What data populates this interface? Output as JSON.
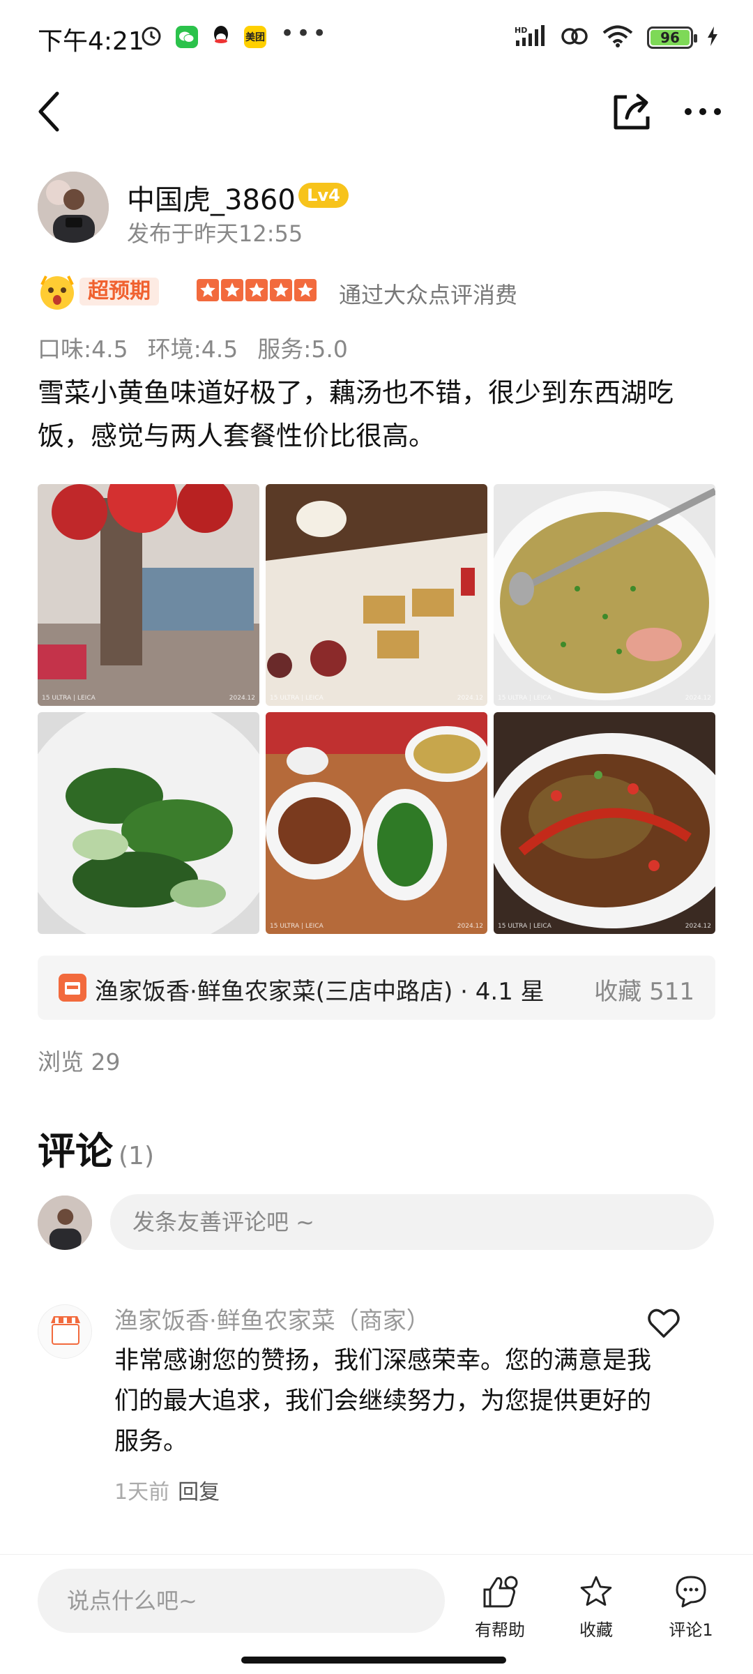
{
  "status_bar": {
    "time": "下午4:21",
    "left_apps": [
      "alarm-icon",
      "wechat-icon",
      "qq-icon",
      "meituan-icon"
    ],
    "meituan_label": "美团",
    "more_dots": "•••",
    "network": "HD",
    "battery": "96"
  },
  "nav": {
    "back_icon": "back-icon",
    "share_icon": "share-icon",
    "more_icon": "more-icon"
  },
  "author": {
    "name": "中国虎_3860",
    "level": "Lv4",
    "posted": "发布于昨天12:55"
  },
  "rating": {
    "tag": "超预期",
    "stars": 5,
    "verify": "通过大众点评消费"
  },
  "scores": {
    "taste": "口味:4.5",
    "environment": "环境:4.5",
    "service": "服务:5.0"
  },
  "review_text": "雪菜小黄鱼味道好极了，藕汤也不错，很少到东西湖吃饭，感觉与两人套餐性价比很高。",
  "photos": [
    {
      "wm": "15 ULTRA | LEICA",
      "date": "2024.12"
    },
    {
      "wm": "15 ULTRA | LEICA",
      "date": "2024.12"
    },
    {
      "wm": "15 ULTRA | LEICA",
      "date": "2024.12"
    },
    {
      "wm": "",
      "date": ""
    },
    {
      "wm": "15 ULTRA | LEICA",
      "date": "2024.12"
    },
    {
      "wm": "15 ULTRA | LEICA",
      "date": "2024.12"
    }
  ],
  "shop": {
    "name": "渔家饭香·鲜鱼农家菜(三店中路店) · 4.1 星",
    "favorites": "收藏 511"
  },
  "views": "浏览 29",
  "comments": {
    "title": "评论",
    "count": "(1)",
    "input_placeholder": "发条友善评论吧 ~"
  },
  "reply": {
    "merchant": "渔家饭香·鲜鱼农家菜（商家）",
    "text": "非常感谢您的赞扬，我们深感荣幸。您的满意是我们的最大追求，我们会继续努力，为您提供更好的服务。",
    "time": "1天前",
    "reply_label": "回复"
  },
  "bottom_bar": {
    "input_placeholder": "说点什么吧~",
    "helpful": "有帮助",
    "favorite": "收藏",
    "comment": "评论1"
  },
  "colors": {
    "accent": "#f26a3d",
    "level_badge": "#f7c31b",
    "battery": "#7ed957"
  }
}
